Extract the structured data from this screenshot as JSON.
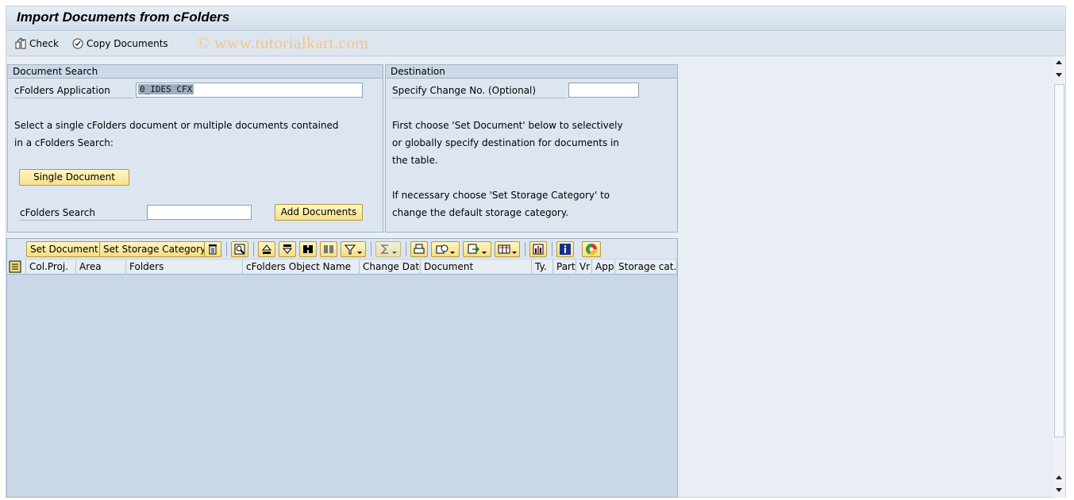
{
  "window": {
    "title": "Import Documents from cFolders"
  },
  "toolbar": {
    "check_label": "Check",
    "copy_label": "Copy Documents",
    "watermark": "© www.tutorialkart.com"
  },
  "search_panel": {
    "heading": "Document Search",
    "app_label": "cFolders Application",
    "app_value": "0_IDES CFX",
    "help_line1": "Select a single cFolders document or multiple documents contained",
    "help_line2": "in a cFolders Search:",
    "single_button": "Single Document",
    "search_label": "cFolders Search",
    "search_value": "",
    "add_button": "Add Documents"
  },
  "destination_panel": {
    "heading": "Destination",
    "change_label": "Specify Change No. (Optional)",
    "change_value": "",
    "help1_line1": "First choose 'Set Document' below to selectively",
    "help1_line2": "or globally specify destination for documents in",
    "help1_line3": "the table.",
    "help2_line1": "If necessary choose 'Set Storage Category' to",
    "help2_line2": "change the default storage category."
  },
  "grid": {
    "set_document": "Set Document",
    "set_storage": "Set Storage Category",
    "columns": [
      "Col.Proj.",
      "Area",
      "Folders",
      "cFolders Object Name",
      "Change Date",
      "Document",
      "Ty.",
      "Part",
      "Vr",
      "App",
      "Storage cat."
    ]
  },
  "icons": {
    "check": "check-icon",
    "copy": "copy-documents-icon",
    "delete": "trash-icon",
    "details": "magnifier-icon",
    "sort_asc": "sort-ascending-icon",
    "sort_desc": "sort-descending-icon",
    "find": "binoculars-icon",
    "find_next": "find-next-icon",
    "filter": "filter-icon",
    "sum": "sum-icon",
    "print": "print-icon",
    "views": "views-icon",
    "export": "export-icon",
    "layout": "layout-icon",
    "graphic": "graphic-icon",
    "info": "info-icon",
    "abc": "abc-analysis-icon"
  }
}
